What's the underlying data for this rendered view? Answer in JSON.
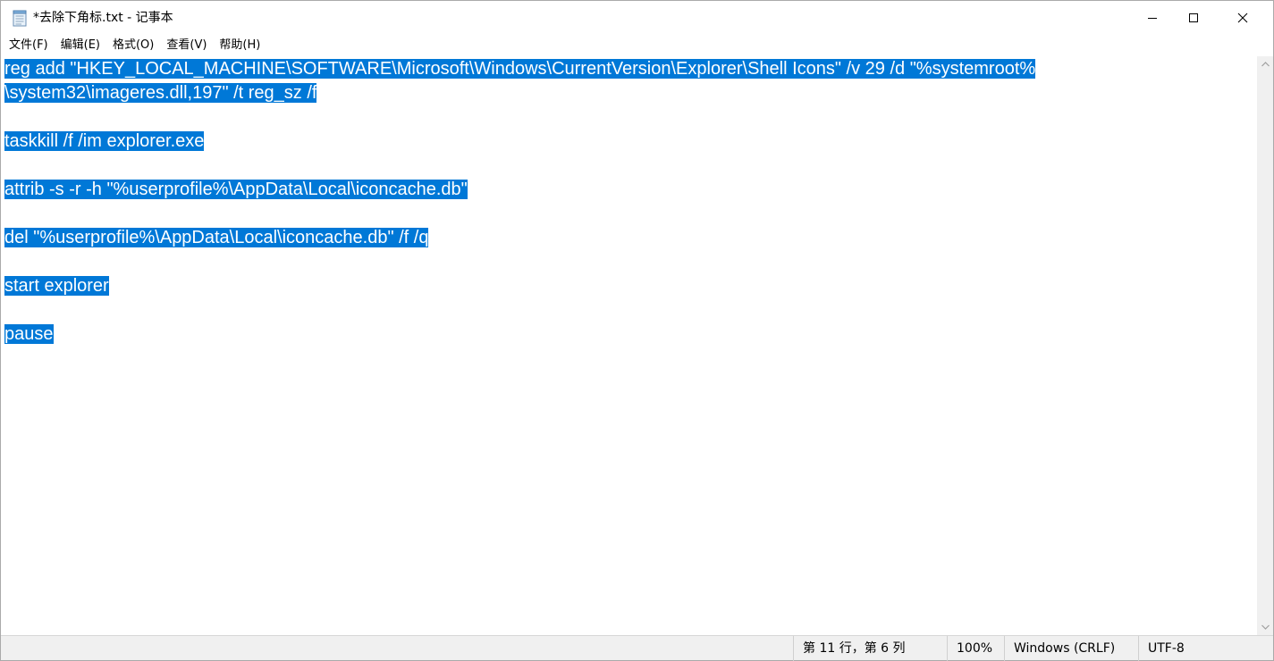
{
  "window": {
    "title": "*去除下角标.txt - 记事本",
    "icon": "notepad-icon"
  },
  "menu": [
    {
      "label": "文件(F)"
    },
    {
      "label": "编辑(E)"
    },
    {
      "label": "格式(O)"
    },
    {
      "label": "查看(V)"
    },
    {
      "label": "帮助(H)"
    }
  ],
  "editor": {
    "lines": [
      "reg add \"HKEY_LOCAL_MACHINE\\SOFTWARE\\Microsoft\\Windows\\CurrentVersion\\Explorer\\Shell Icons\" /v 29 /d \"%systemroot%",
      "\\system32\\imageres.dll,197\" /t reg_sz /f",
      "",
      "taskkill /f /im explorer.exe",
      "",
      "attrib -s -r -h \"%userprofile%\\AppData\\Local\\iconcache.db\"",
      "",
      "del \"%userprofile%\\AppData\\Local\\iconcache.db\" /f /q",
      "",
      "start explorer",
      "",
      "pause"
    ],
    "selection_color": "#0078d7"
  },
  "status": {
    "position": "第 11 行，第 6 列",
    "zoom": "100%",
    "line_ending": "Windows (CRLF)",
    "encoding": "UTF-8"
  }
}
